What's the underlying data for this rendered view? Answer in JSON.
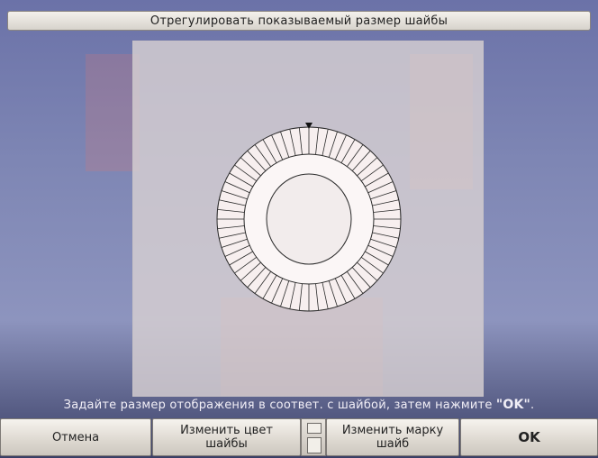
{
  "title": "Отрегулировать показываемый размер шайбы",
  "hint": {
    "prefix": "Задайте размер отображения в соответ. с шайбой, затем нажмите ",
    "ok_word": "\"OK\"",
    "suffix": "."
  },
  "buttons": {
    "cancel": "Отмена",
    "change_color_line1": "Изменить цвет",
    "change_color_line2": "шайбы",
    "change_brand_line1": "Изменить марку",
    "change_brand_line2": "шайб",
    "ok": "OK"
  },
  "washer": {
    "segments": 60,
    "outer_fill": "#f7efef",
    "stroke": "#2a2a2a"
  },
  "icons": {
    "marker": "position-marker-icon",
    "toggle": "size-toggle-icon"
  }
}
